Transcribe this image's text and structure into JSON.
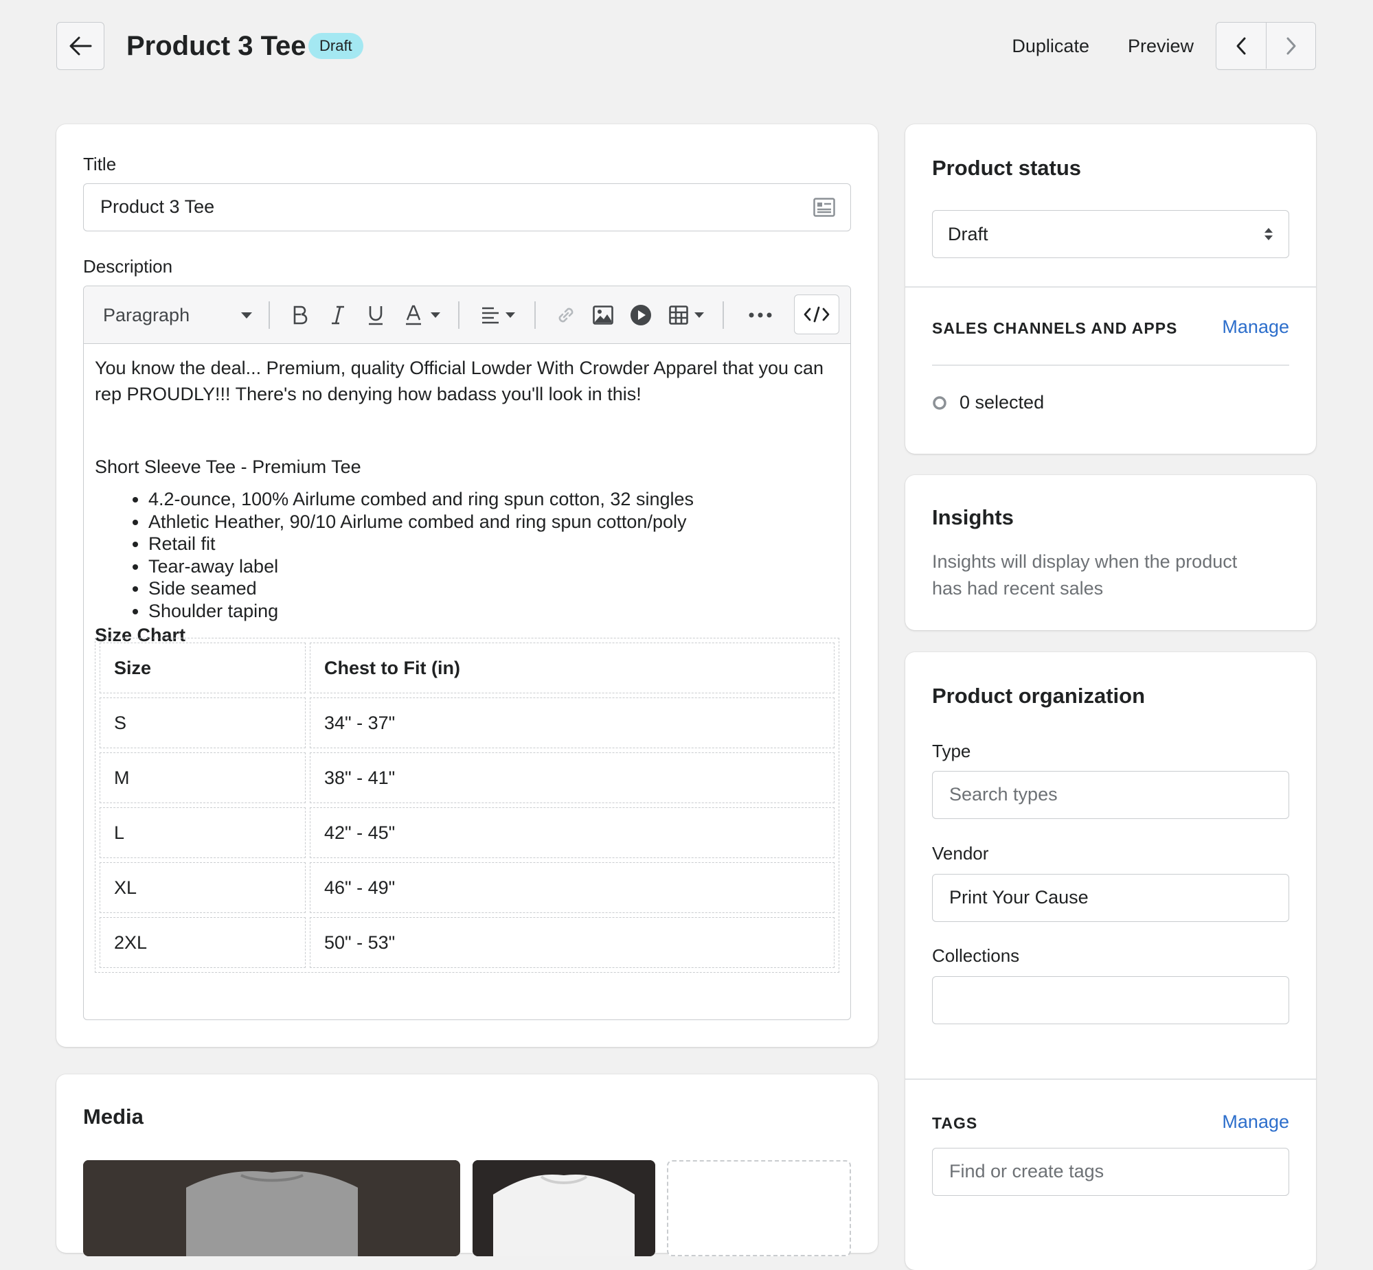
{
  "header": {
    "title": "Product 3 Tee",
    "status_badge": "Draft",
    "actions": {
      "duplicate": "Duplicate",
      "preview": "Preview"
    }
  },
  "main": {
    "title_label": "Title",
    "title_value": "Product 3 Tee",
    "description_label": "Description",
    "toolbar": {
      "paragraph": "Paragraph"
    },
    "description": {
      "intro": "You know the deal... Premium, quality Official Lowder With Crowder Apparel that you can rep PROUDLY!!! There's no denying how badass you'll look in this!",
      "subtitle": "Short Sleeve Tee - Premium Tee",
      "features": [
        "4.2-ounce, 100% Airlume combed and ring spun cotton, 32 singles",
        "Athletic Heather, 90/10 Airlume combed and ring spun cotton/poly",
        "Retail fit",
        "Tear-away label",
        "Side seamed",
        "Shoulder taping"
      ],
      "size_chart_title": "Size Chart",
      "size_table": {
        "headers": [
          "Size",
          "Chest to Fit (in)"
        ],
        "rows": [
          [
            "S",
            "34\" - 37\""
          ],
          [
            "M",
            "38\" - 41\""
          ],
          [
            "L",
            "42\" - 45\""
          ],
          [
            "XL",
            "46\" - 49\""
          ],
          [
            "2XL",
            "50\" - 53\""
          ]
        ]
      }
    }
  },
  "media": {
    "title": "Media"
  },
  "product_status": {
    "title": "Product status",
    "selected": "Draft",
    "sales_channels_heading": "SALES CHANNELS AND APPS",
    "manage": "Manage",
    "selected_count": "0 selected"
  },
  "insights": {
    "title": "Insights",
    "text_line1": "Insights will display when the product",
    "text_line2": "has had recent sales"
  },
  "organization": {
    "title": "Product organization",
    "type_label": "Type",
    "type_placeholder": "Search types",
    "vendor_label": "Vendor",
    "vendor_value": "Print Your Cause",
    "collections_label": "Collections",
    "collections_value": "",
    "tags_heading": "TAGS",
    "tags_manage": "Manage",
    "tags_placeholder": "Find or create tags"
  },
  "colors": {
    "background": "#f1f1f1",
    "link": "#2c6ecb",
    "badge": "#a4e8f2",
    "border": "#c9cccf"
  }
}
